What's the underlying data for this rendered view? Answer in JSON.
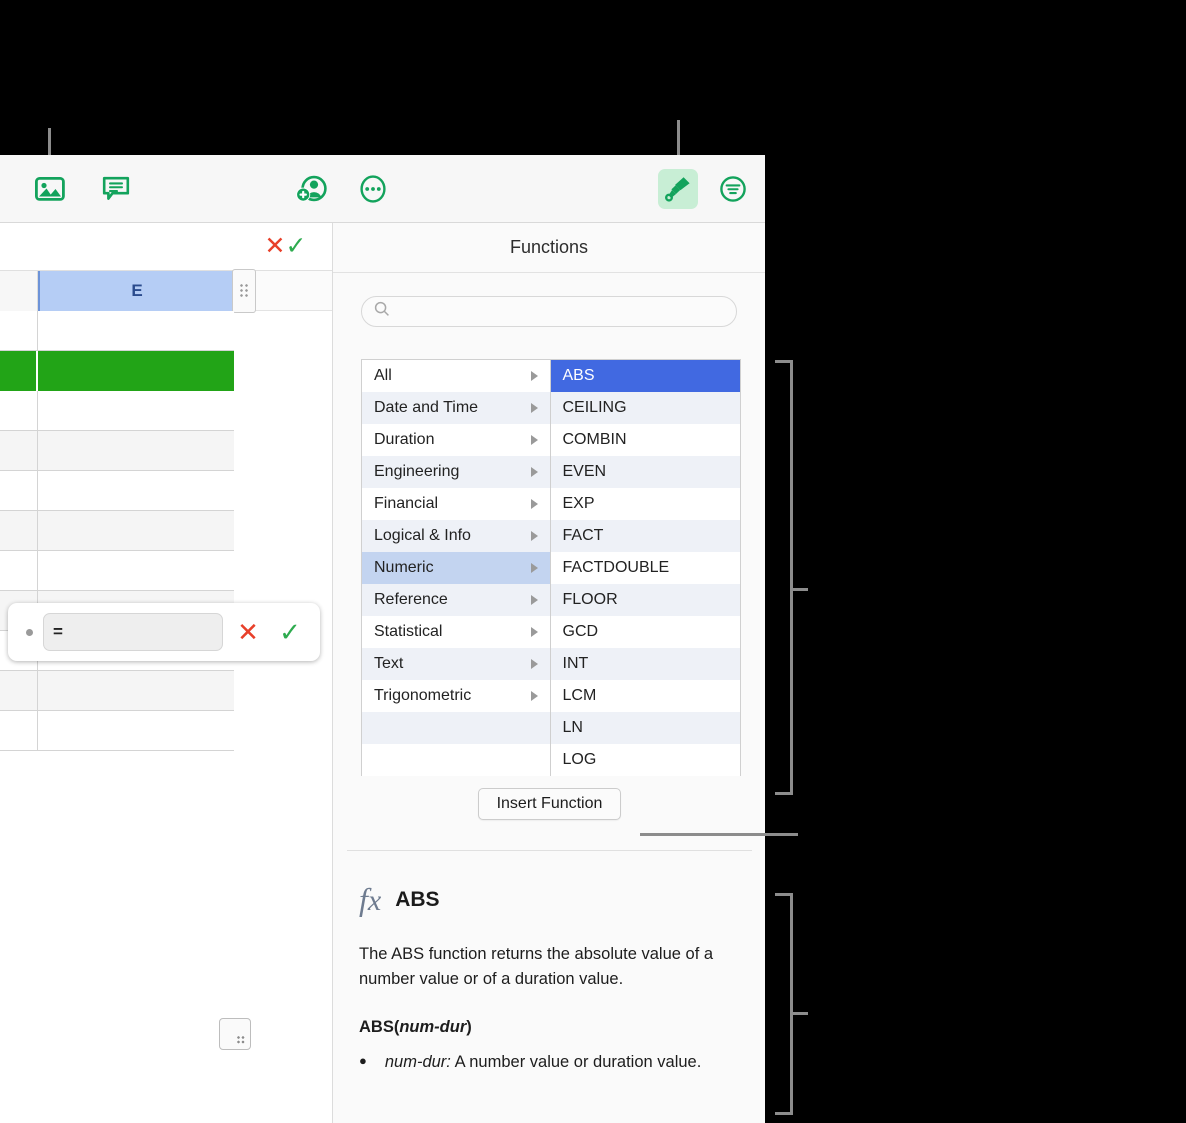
{
  "toolbar": {
    "buttons": [
      {
        "name": "media-icon",
        "label": "Media"
      },
      {
        "name": "comment-icon",
        "label": "Comment"
      },
      {
        "name": "collaborate-icon",
        "label": "Collaborate"
      },
      {
        "name": "more-icon",
        "label": "More"
      },
      {
        "name": "format-icon",
        "label": "Format",
        "active": true
      },
      {
        "name": "organize-icon",
        "label": "Organize"
      }
    ]
  },
  "sheet": {
    "selected_column_header": "E",
    "formula_editor": {
      "value": "=",
      "cancel_label": "✕",
      "accept_label": "✓"
    },
    "strip": {
      "cancel_label": "✕",
      "accept_label": "✓"
    }
  },
  "panel": {
    "title": "Functions",
    "search": {
      "value": "",
      "placeholder": ""
    },
    "categories": [
      {
        "label": "All",
        "selected": false
      },
      {
        "label": "Date and Time",
        "selected": false
      },
      {
        "label": "Duration",
        "selected": false
      },
      {
        "label": "Engineering",
        "selected": false
      },
      {
        "label": "Financial",
        "selected": false
      },
      {
        "label": "Logical & Info",
        "selected": false
      },
      {
        "label": "Numeric",
        "selected": true
      },
      {
        "label": "Reference",
        "selected": false
      },
      {
        "label": "Statistical",
        "selected": false
      },
      {
        "label": "Text",
        "selected": false
      },
      {
        "label": "Trigonometric",
        "selected": false
      }
    ],
    "functions": [
      {
        "label": "ABS",
        "selected": true
      },
      {
        "label": "CEILING",
        "selected": false
      },
      {
        "label": "COMBIN",
        "selected": false
      },
      {
        "label": "EVEN",
        "selected": false
      },
      {
        "label": "EXP",
        "selected": false
      },
      {
        "label": "FACT",
        "selected": false
      },
      {
        "label": "FACTDOUBLE",
        "selected": false
      },
      {
        "label": "FLOOR",
        "selected": false
      },
      {
        "label": "GCD",
        "selected": false
      },
      {
        "label": "INT",
        "selected": false
      },
      {
        "label": "LCM",
        "selected": false
      },
      {
        "label": "LN",
        "selected": false
      },
      {
        "label": "LOG",
        "selected": false
      }
    ],
    "insert_button_label": "Insert Function",
    "description": {
      "icon": "fx-icon",
      "name": "ABS",
      "body": "The ABS function returns the absolute value of a number value or of a duration value.",
      "signature_fn": "ABS",
      "signature_arg": "num-dur",
      "arg_bullet": "●",
      "arg_name": "num-dur:",
      "arg_text": " A number value or duration value."
    }
  },
  "colors": {
    "accent_green": "#13a35c",
    "format_active_bg": "#c8eed5",
    "selection_blue": "#4169e1",
    "category_selected": "#c3d4f0",
    "column_header_selected": "#b5cdf5",
    "green_row": "#22a417",
    "cancel_red": "#e8402a",
    "accept_green": "#2eab4f",
    "callout_gray": "#8c8c8c"
  }
}
